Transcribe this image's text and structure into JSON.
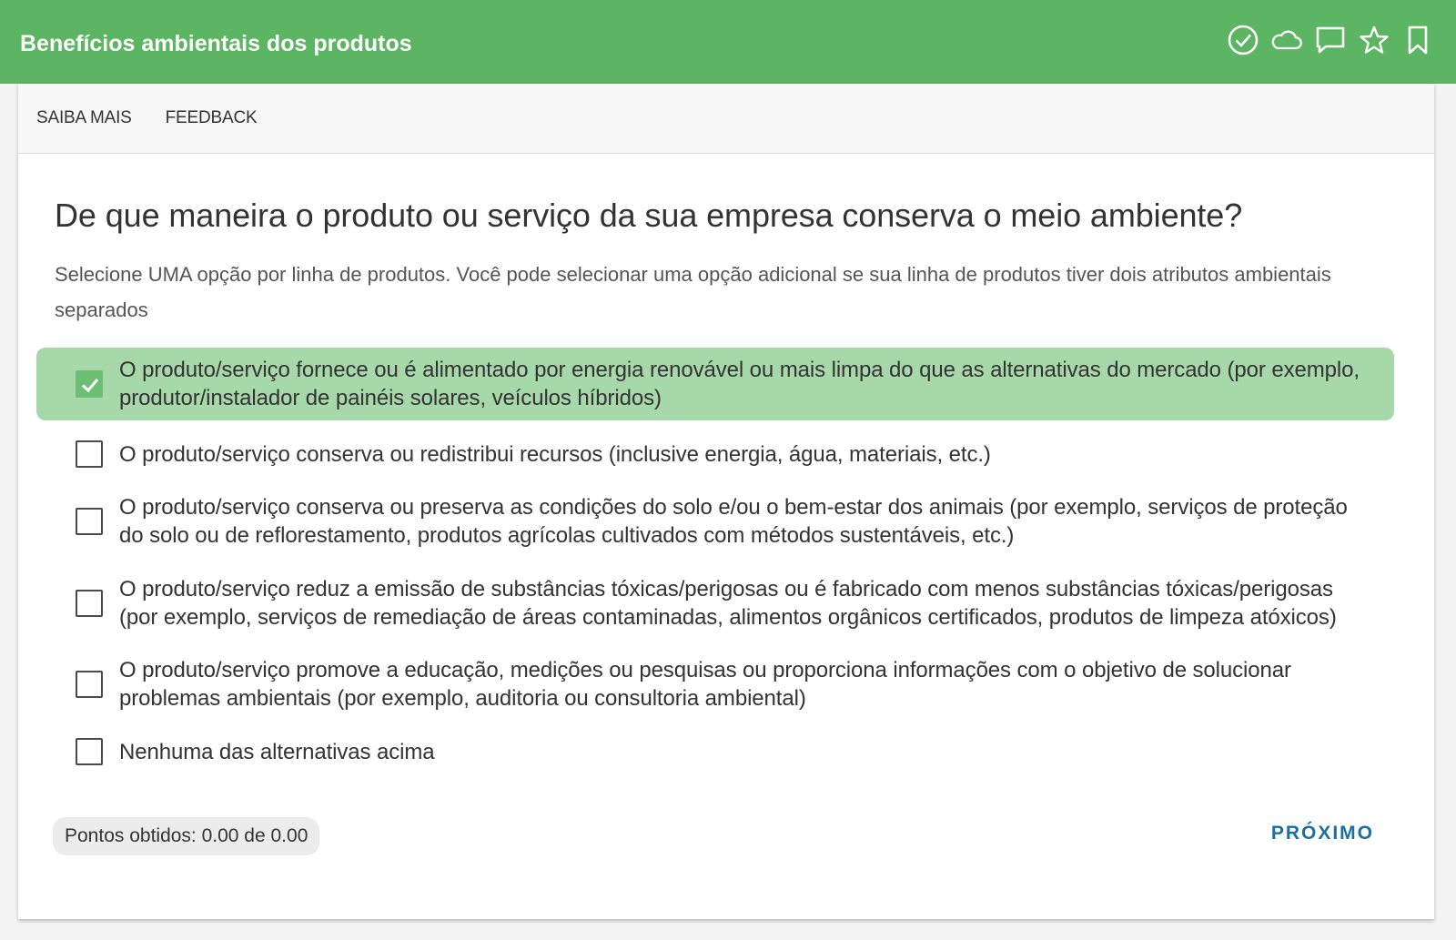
{
  "header": {
    "title": "Benefícios ambientais dos produtos",
    "icons": [
      "check-circle-icon",
      "cloud-icon",
      "comment-icon",
      "star-icon",
      "bookmark-icon"
    ]
  },
  "tabs": [
    "SAIBA MAIS",
    "FEEDBACK"
  ],
  "question": {
    "title": "De que maneira o produto ou serviço da sua empresa conserva o meio ambiente?",
    "instructions": "Selecione UMA opção por linha de produtos. Você pode selecionar uma opção adicional se sua linha de produtos tiver dois atributos ambientais separados"
  },
  "options": [
    {
      "label": "O produto/serviço fornece ou é alimentado por energia renovável ou mais limpa do que as alternativas do mercado (por exemplo, produtor/instalador de painéis solares, veículos híbridos)",
      "checked": true
    },
    {
      "label": "O produto/serviço conserva ou redistribui recursos (inclusive energia, água, materiais, etc.)",
      "checked": false
    },
    {
      "label": "O produto/serviço conserva ou preserva as condições do solo e/ou o bem-estar dos animais (por exemplo, serviços de proteção do solo ou de reflorestamento, produtos agrícolas cultivados com métodos sustentáveis, etc.)",
      "checked": false
    },
    {
      "label": "O produto/serviço reduz a emissão de substâncias tóxicas/perigosas ou é fabricado com menos substâncias tóxicas/perigosas (por exemplo, serviços de remediação de áreas contaminadas, alimentos orgânicos certificados, produtos de limpeza atóxicos)",
      "checked": false
    },
    {
      "label": "O produto/serviço promove a educação, medições ou pesquisas ou proporciona informações com o objetivo de solucionar problemas ambientais (por exemplo, auditoria ou consultoria ambiental)",
      "checked": false
    },
    {
      "label": "Nenhuma das alternativas acima",
      "checked": false
    }
  ],
  "footer": {
    "points": "Pontos obtidos: 0.00 de 0.00",
    "next_label": "PRÓXIMO"
  },
  "colors": {
    "header_bg": "#5cb562",
    "selected_bg": "#a7d8a9",
    "next_text": "#1d6fa0"
  }
}
